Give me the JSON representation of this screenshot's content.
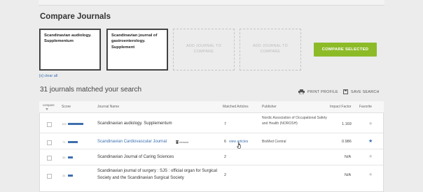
{
  "page_title": "Compare Journals",
  "compare_slots": [
    {
      "label": "Scandinavian audiology. Supplementum",
      "filled": true
    },
    {
      "label": "Scandinavian journal of gastroenterology. Supplement",
      "filled": true
    },
    {
      "label": "ADD JOURNAL TO COMPARE",
      "filled": false
    },
    {
      "label": "ADD JOURNAL TO COMPARE",
      "filled": false
    }
  ],
  "compare_button": "COMPARE SELECTED",
  "clear_all": "[x] clear all",
  "results_count": "31 journals matched your search",
  "actions": {
    "print": "PRINT PROFILE",
    "save": "SAVE SEARCH"
  },
  "columns": {
    "compare": "compare",
    "score": "Score",
    "journal": "Journal Name",
    "matched": "Matched Articles",
    "publisher": "Publisher",
    "impact": "Impact Factor",
    "favorite": "Favorite"
  },
  "rows": [
    {
      "score_value": "109",
      "score_fraction": 0.9,
      "journal": "Scandinavian audiology. Supplementum",
      "matched": "7",
      "publisher": "Nordic Association of Occupational Safety and Health (NOROSH)",
      "impact": "1.169",
      "favorite": false,
      "link": false
    },
    {
      "score_value": "71",
      "score_fraction": 0.6,
      "journal": "Scandinavian Cardiovascular Journal",
      "remove": "remove",
      "matched": "6",
      "view": "view articles",
      "publisher": "BioMed Central",
      "impact": "0.986",
      "favorite": true,
      "link": true
    },
    {
      "score_value": "35",
      "score_fraction": 0.3,
      "journal": "Scandinavian Journal of Caring Sciences",
      "matched": "2",
      "publisher": "",
      "impact": "N/A",
      "favorite": false,
      "link": false
    },
    {
      "score_value": "34",
      "score_fraction": 0.28,
      "journal": "Scandinavian journal of surgery : SJS : official organ for Surgical Society and the Scandinavian Surgical Society",
      "matched": "2",
      "publisher": "",
      "impact": "N/A",
      "favorite": false,
      "link": false
    }
  ],
  "colors": {
    "accent_green": "#8dbb28",
    "link_blue": "#3a6fb0",
    "bar_blue": "#3e6fae"
  }
}
